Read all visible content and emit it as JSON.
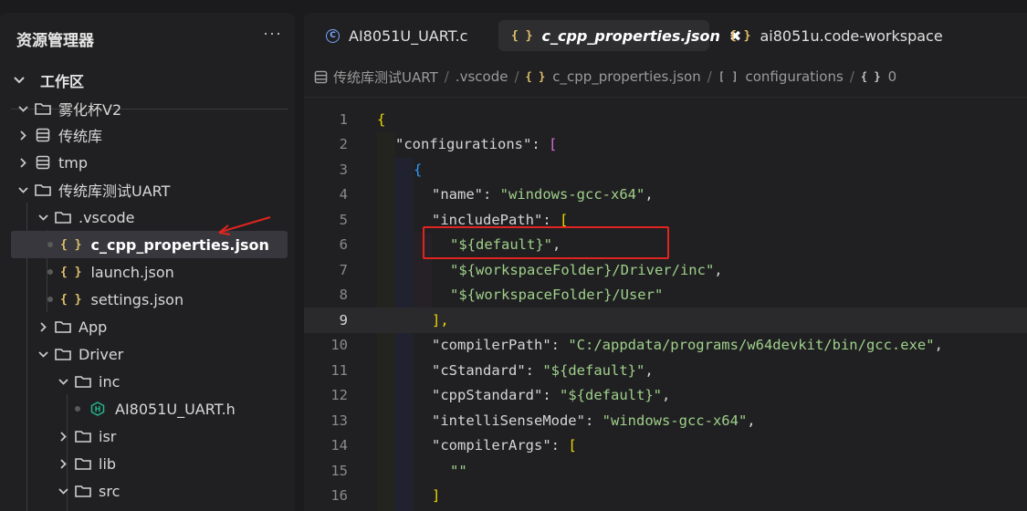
{
  "sidebar": {
    "title": "资源管理器",
    "more": "···",
    "workspace_label": "工作区",
    "tree": [
      {
        "label": "雾化杯V2",
        "type": "folder",
        "expanded": true
      },
      {
        "label": "传统库",
        "type": "db",
        "expanded": false
      },
      {
        "label": "tmp",
        "type": "db",
        "expanded": false
      },
      {
        "label": "传统库测试UART",
        "type": "folder",
        "expanded": true
      },
      {
        "label": ".vscode",
        "type": "folder",
        "expanded": true
      },
      {
        "label": "c_cpp_properties.json",
        "type": "json",
        "selected": true
      },
      {
        "label": "launch.json",
        "type": "json"
      },
      {
        "label": "settings.json",
        "type": "json"
      },
      {
        "label": "App",
        "type": "folder",
        "expanded": false
      },
      {
        "label": "Driver",
        "type": "folder",
        "expanded": true
      },
      {
        "label": "inc",
        "type": "folder",
        "expanded": true
      },
      {
        "label": "AI8051U_UART.h",
        "type": "header"
      },
      {
        "label": "isr",
        "type": "folder",
        "expanded": false
      },
      {
        "label": "lib",
        "type": "folder",
        "expanded": false
      },
      {
        "label": "src",
        "type": "folder",
        "expanded": true
      }
    ]
  },
  "tabs": [
    {
      "label": "AI8051U_UART.c",
      "icon": "c-file-icon",
      "active": false
    },
    {
      "label": "c_cpp_properties.json",
      "icon": "json-icon",
      "active": true,
      "close": "✖"
    },
    {
      "label": "ai8051u.code-workspace",
      "icon": "json-icon",
      "active": false
    }
  ],
  "breadcrumb": [
    "传统库测试UART",
    ".vscode",
    "c_cpp_properties.json",
    "configurations",
    "0"
  ],
  "code": {
    "lines": [
      "1",
      "2",
      "3",
      "4",
      "5",
      "6",
      "7",
      "8",
      "9",
      "10",
      "11",
      "12",
      "13",
      "14",
      "15",
      "16"
    ],
    "current_line": "9",
    "l1": "{",
    "l2_key": "\"configurations\"",
    "l2_colon": ": ",
    "l2_bracket": "[",
    "l3": "{",
    "l4_key": "\"name\"",
    "l4_val": "\"windows-gcc-x64\"",
    "l5_key": "\"includePath\"",
    "l5_bracket": "[",
    "l6_val": "\"${default}\"",
    "l7_val": "\"${workspaceFolder}/Driver/inc\"",
    "l8_val": "\"${workspaceFolder}/User\"",
    "l9": "],",
    "l10_key": "\"compilerPath\"",
    "l10_val": "\"C:/appdata/programs/w64devkit/bin/gcc.exe\"",
    "l11_key": "\"cStandard\"",
    "l11_val": "\"${default}\"",
    "l12_key": "\"cppStandard\"",
    "l12_val": "\"${default}\"",
    "l13_key": "\"intelliSenseMode\"",
    "l13_val": "\"windows-gcc-x64\"",
    "l14_key": "\"compilerArgs\"",
    "l14_bracket": "[",
    "l15_val": "\"\"",
    "l16": "]",
    "colon": ": ",
    "comma": ","
  },
  "colors": {
    "highlight_box": "#e0241f",
    "annotation_arrow": "#e0241f",
    "string": "#9fd08a",
    "brace_yellow": "#f1d700"
  }
}
